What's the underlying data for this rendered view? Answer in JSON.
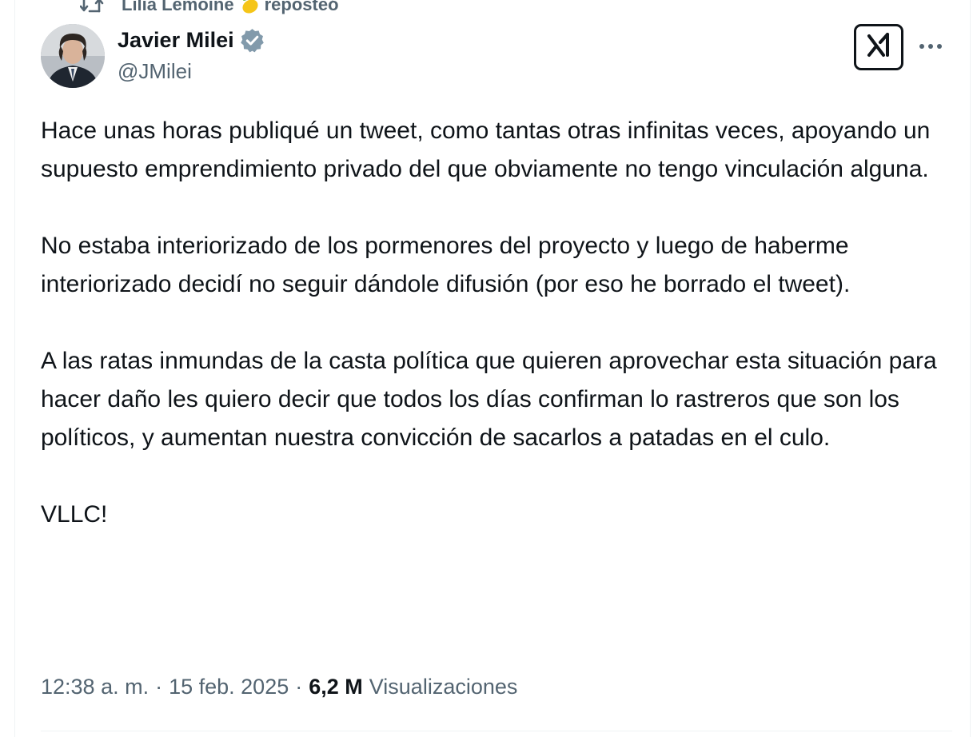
{
  "repost": {
    "icon": "repost-icon",
    "user": "Lilia Lemoine",
    "emoji": "lemon-emoji",
    "label": "reposteó"
  },
  "author": {
    "name": "Javier Milei",
    "handle": "@JMilei",
    "verified_icon": "verified-badge-icon",
    "verified_color": "#829aab",
    "avatar": "avatar"
  },
  "actions": {
    "grok_icon": "grok-icon",
    "more_icon": "more-options-icon"
  },
  "tweet": {
    "paragraphs": [
      "Hace unas horas publiqué un tweet, como tantas otras infinitas veces, apoyando un supuesto emprendimiento privado del que obviamente no tengo vinculación alguna.",
      "No estaba interiorizado de los pormenores del proyecto y luego de haberme interiorizado decidí no seguir dándole difusión (por eso he borrado el tweet).",
      "A las ratas inmundas de la casta política que quieren aprovechar esta situación para hacer daño les quiero decir que todos los días confirman lo rastreros que son los políticos, y aumentan nuestra convicción de sacarlos a patadas en el culo.",
      "VLLC!"
    ]
  },
  "meta": {
    "time": "12:38 a. m.",
    "separator": "·",
    "date": "15 feb. 2025",
    "views_count": "6,2 M",
    "views_label": "Visualizaciones"
  },
  "colors": {
    "text_primary": "#0f1419",
    "text_secondary": "#536471",
    "divider": "#eff3f4"
  }
}
